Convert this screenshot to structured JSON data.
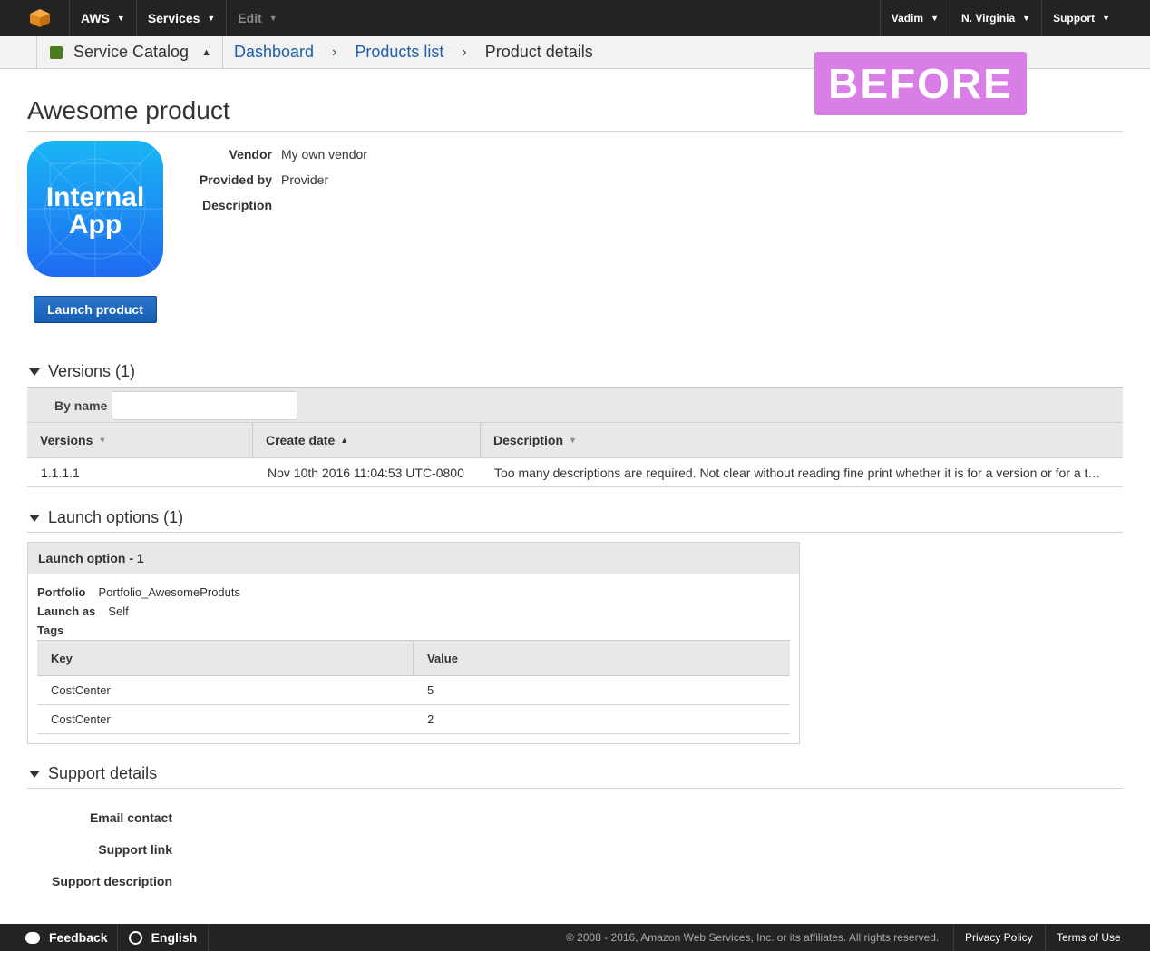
{
  "topnav": {
    "brand": "AWS",
    "services": "Services",
    "edit": "Edit",
    "user": "Vadim",
    "region": "N. Virginia",
    "support": "Support"
  },
  "breadcrumb": {
    "service": "Service Catalog",
    "items": [
      "Dashboard",
      "Products list",
      "Product details"
    ]
  },
  "stamp": "BEFORE",
  "product": {
    "title": "Awesome product",
    "icon_line1": "Internal",
    "icon_line2": "App",
    "launch_label": "Launch product",
    "vendor_label": "Vendor",
    "vendor": "My own vendor",
    "provided_label": "Provided by",
    "provided": "Provider",
    "description_label": "Description"
  },
  "versions": {
    "heading": "Versions (1)",
    "filter_label": "By name",
    "filter_value": "",
    "columns": [
      "Versions",
      "Create date",
      "Description"
    ],
    "rows": [
      [
        "1.1.1.1",
        "Nov 10th 2016 11:04:53 UTC-0800",
        "Too many descriptions are required. Not clear without reading fine print whether it is for a version or for a t…"
      ]
    ]
  },
  "launch_options": {
    "heading": "Launch options (1)",
    "panel_title": "Launch option - 1",
    "portfolio_label": "Portfolio",
    "portfolio": "Portfolio_AwesomeProduts",
    "launch_as_label": "Launch as",
    "launch_as": "Self",
    "tags_label": "Tags",
    "tag_columns": [
      "Key",
      "Value"
    ],
    "tags": [
      [
        "CostCenter",
        "5"
      ],
      [
        "CostCenter",
        "2"
      ]
    ]
  },
  "support_details": {
    "heading": "Support details",
    "email_label": "Email contact",
    "link_label": "Support link",
    "desc_label": "Support description"
  },
  "footer": {
    "feedback": "Feedback",
    "language": "English",
    "copyright": "© 2008 - 2016, Amazon Web Services, Inc. or its affiliates. All rights reserved.",
    "privacy": "Privacy Policy",
    "terms": "Terms of Use"
  },
  "colors": {
    "nav_bg": "#232323",
    "link": "#1f5fa8",
    "button": "#155fb5",
    "stamp": "#d97ee6"
  }
}
